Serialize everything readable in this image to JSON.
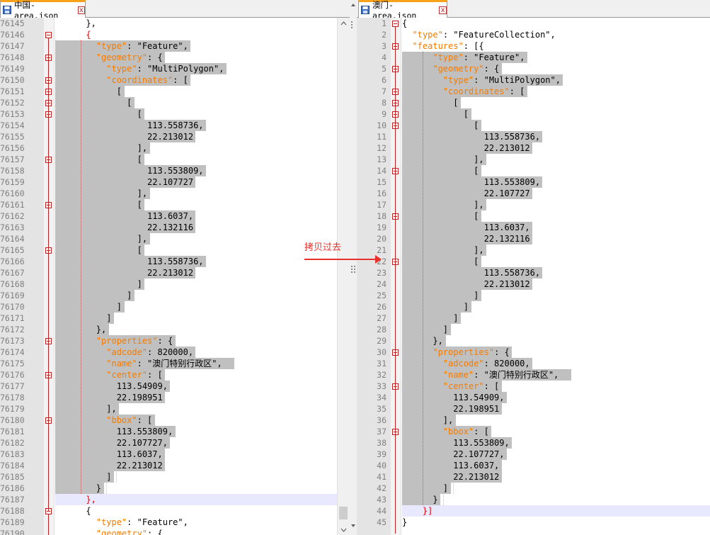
{
  "left_tab": {
    "title": "中国-area.json",
    "close_glyph": "x",
    "icon": "save-icon"
  },
  "right_tab": {
    "title": "澳门-area.json",
    "close_glyph": "x",
    "icon": "save-icon"
  },
  "annotation": {
    "text": "拷贝过去"
  },
  "colors": {
    "key": "#f57b00",
    "selection": "#c0c0c0",
    "current_line": "#e8e8ff",
    "fold_marker": "#c02020",
    "tab_accent": "#f7a21b",
    "annotation": "#e8302a"
  },
  "left_lines": [
    {
      "n": "76145",
      "t": "      },"
    },
    {
      "n": "76146",
      "t": "      {"
    },
    {
      "n": "76147",
      "t": "        \"type\": \"Feature\","
    },
    {
      "n": "76148",
      "t": "        \"geometry\": {"
    },
    {
      "n": "76149",
      "t": "          \"type\": \"MultiPolygon\","
    },
    {
      "n": "76150",
      "t": "          \"coordinates\": ["
    },
    {
      "n": "76151",
      "t": "            ["
    },
    {
      "n": "76152",
      "t": "              ["
    },
    {
      "n": "76153",
      "t": "                ["
    },
    {
      "n": "76154",
      "t": "                  113.558736,"
    },
    {
      "n": "76155",
      "t": "                  22.213012"
    },
    {
      "n": "76156",
      "t": "                ],"
    },
    {
      "n": "76157",
      "t": "                ["
    },
    {
      "n": "76158",
      "t": "                  113.553809,"
    },
    {
      "n": "76159",
      "t": "                  22.107727"
    },
    {
      "n": "76160",
      "t": "                ],"
    },
    {
      "n": "76161",
      "t": "                ["
    },
    {
      "n": "76162",
      "t": "                  113.6037,"
    },
    {
      "n": "76163",
      "t": "                  22.132116"
    },
    {
      "n": "76164",
      "t": "                ],"
    },
    {
      "n": "76165",
      "t": "                ["
    },
    {
      "n": "76166",
      "t": "                  113.558736,"
    },
    {
      "n": "76167",
      "t": "                  22.213012"
    },
    {
      "n": "76168",
      "t": "                ]"
    },
    {
      "n": "76169",
      "t": "              ]"
    },
    {
      "n": "76170",
      "t": "            ]"
    },
    {
      "n": "76171",
      "t": "          ]"
    },
    {
      "n": "76172",
      "t": "        },"
    },
    {
      "n": "76173",
      "t": "        \"properties\": {"
    },
    {
      "n": "76174",
      "t": "          \"adcode\": 820000,"
    },
    {
      "n": "76175",
      "t": "          \"name\": \"澳门特别行政区\","
    },
    {
      "n": "76176",
      "t": "          \"center\": ["
    },
    {
      "n": "76177",
      "t": "            113.54909,"
    },
    {
      "n": "76178",
      "t": "            22.198951"
    },
    {
      "n": "76179",
      "t": "          ],"
    },
    {
      "n": "76180",
      "t": "          \"bbox\": ["
    },
    {
      "n": "76181",
      "t": "            113.553809,"
    },
    {
      "n": "76182",
      "t": "            22.107727,"
    },
    {
      "n": "76183",
      "t": "            113.6037,"
    },
    {
      "n": "76184",
      "t": "            22.213012"
    },
    {
      "n": "76185",
      "t": "          ]"
    },
    {
      "n": "76186",
      "t": "        }"
    },
    {
      "n": "76187",
      "t": "      },"
    },
    {
      "n": "76188",
      "t": "      {"
    },
    {
      "n": "76189",
      "t": "        \"type\": \"Feature\","
    },
    {
      "n": "76190",
      "t": "        \"geometry\": {"
    }
  ],
  "right_lines": [
    {
      "n": "1",
      "t": "{"
    },
    {
      "n": "2",
      "t": "  \"type\": \"FeatureCollection\","
    },
    {
      "n": "3",
      "t": "  \"features\": [{"
    },
    {
      "n": "4",
      "t": "      \"type\": \"Feature\","
    },
    {
      "n": "5",
      "t": "      \"geometry\": {"
    },
    {
      "n": "6",
      "t": "        \"type\": \"MultiPolygon\","
    },
    {
      "n": "7",
      "t": "        \"coordinates\": ["
    },
    {
      "n": "8",
      "t": "          ["
    },
    {
      "n": "9",
      "t": "            ["
    },
    {
      "n": "10",
      "t": "              ["
    },
    {
      "n": "11",
      "t": "                113.558736,"
    },
    {
      "n": "12",
      "t": "                22.213012"
    },
    {
      "n": "13",
      "t": "              ],"
    },
    {
      "n": "14",
      "t": "              ["
    },
    {
      "n": "15",
      "t": "                113.553809,"
    },
    {
      "n": "16",
      "t": "                22.107727"
    },
    {
      "n": "17",
      "t": "              ],"
    },
    {
      "n": "18",
      "t": "              ["
    },
    {
      "n": "19",
      "t": "                113.6037,"
    },
    {
      "n": "20",
      "t": "                22.132116"
    },
    {
      "n": "21",
      "t": "              ],"
    },
    {
      "n": "22",
      "t": "              ["
    },
    {
      "n": "23",
      "t": "                113.558736,"
    },
    {
      "n": "24",
      "t": "                22.213012"
    },
    {
      "n": "25",
      "t": "              ]"
    },
    {
      "n": "26",
      "t": "            ]"
    },
    {
      "n": "27",
      "t": "          ]"
    },
    {
      "n": "28",
      "t": "        ]"
    },
    {
      "n": "29",
      "t": "      },"
    },
    {
      "n": "30",
      "t": "      \"properties\": {"
    },
    {
      "n": "31",
      "t": "        \"adcode\": 820000,"
    },
    {
      "n": "32",
      "t": "        \"name\": \"澳门特别行政区\","
    },
    {
      "n": "33",
      "t": "        \"center\": ["
    },
    {
      "n": "34",
      "t": "          113.54909,"
    },
    {
      "n": "35",
      "t": "          22.198951"
    },
    {
      "n": "36",
      "t": "        ],"
    },
    {
      "n": "37",
      "t": "        \"bbox\": ["
    },
    {
      "n": "38",
      "t": "          113.553809,"
    },
    {
      "n": "39",
      "t": "          22.107727,"
    },
    {
      "n": "40",
      "t": "          113.6037,"
    },
    {
      "n": "41",
      "t": "          22.213012"
    },
    {
      "n": "42",
      "t": "        ]"
    },
    {
      "n": "43",
      "t": "      }"
    },
    {
      "n": "44",
      "t": "    }]"
    },
    {
      "n": "45",
      "t": "}"
    }
  ]
}
